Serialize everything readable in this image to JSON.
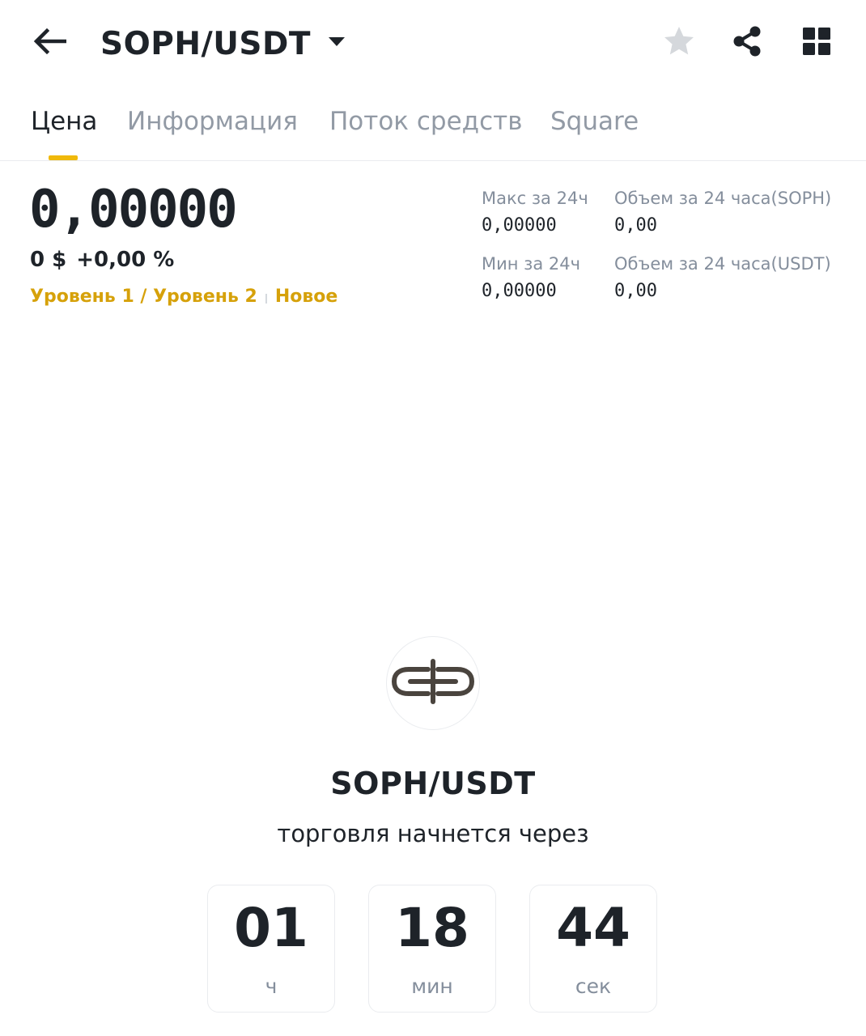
{
  "header": {
    "pair": "SOPH/USDT"
  },
  "tabs": [
    {
      "label": "Цена",
      "active": true
    },
    {
      "label": "Информация",
      "active": false
    },
    {
      "label": "Поток средств",
      "active": false
    },
    {
      "label": "Square",
      "active": false
    }
  ],
  "price": {
    "last": "0,00000",
    "usd": "0 $",
    "change": "+0,00 %"
  },
  "tags": {
    "level": "Уровень 1 / Уровень 2",
    "new": "Новое"
  },
  "stats": {
    "high_label": "Макс за 24ч",
    "high_value": "0,00000",
    "low_label": "Мин за 24ч",
    "low_value": "0,00000",
    "vol_base_label": "Объем за 24 часа(SOPH)",
    "vol_base_value": "0,00",
    "vol_quote_label": "Объем за 24 часа(USDT)",
    "vol_quote_value": "0,00"
  },
  "countdown": {
    "pair": "SOPH/USDT",
    "subtitle": "торговля начнется через",
    "hours": "01",
    "hours_unit": "ч",
    "minutes": "18",
    "minutes_unit": "мин",
    "seconds": "44",
    "seconds_unit": "сек"
  },
  "icons": {
    "back": "arrow-left-icon",
    "dropdown": "caret-down-icon",
    "favorite": "star-icon",
    "share": "share-icon",
    "menu": "grid-icon",
    "token": "soph-logo-icon"
  },
  "colors": {
    "accent": "#f0b90b",
    "tag": "#d6a10a",
    "text_primary": "#1e2329",
    "text_secondary": "#848e9c",
    "star_inactive": "#d5d8dc"
  }
}
